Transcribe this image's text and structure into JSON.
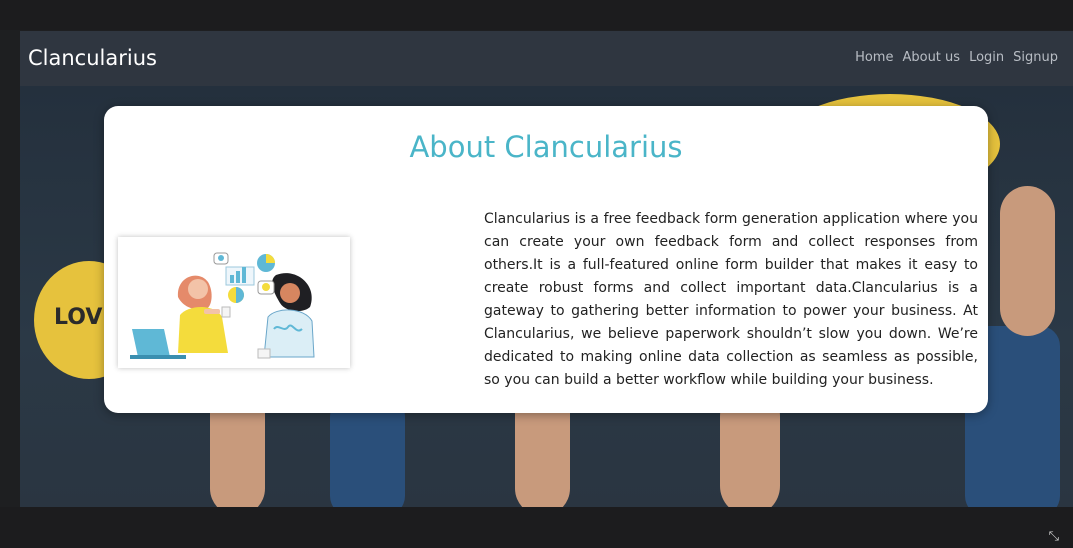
{
  "navbar": {
    "brand": "Clancularius",
    "links": [
      {
        "label": "Home"
      },
      {
        "label": "About us"
      },
      {
        "label": "Login"
      },
      {
        "label": "Signup"
      }
    ]
  },
  "background": {
    "bubble_text": "LOV"
  },
  "about": {
    "title": "About Clancularius",
    "text": "Clancularius is a free feedback form generation application where you can create your own feedback form and collect responses from others.It is a full-featured online form builder that makes it easy to create robust forms and collect important data.Clancularius is a gateway to gathering better information to power your business. At Clancularius, we believe paperwork shouldn’t slow you down. We’re dedicated to making online data collection as seamless as possible, so you can build a better workflow while building your business."
  },
  "colors": {
    "accent": "#4ab5c8",
    "navbar": "#2f3640",
    "bubble": "#e6c23d"
  },
  "icons": {
    "fullscreen": "exit-fullscreen-icon"
  }
}
